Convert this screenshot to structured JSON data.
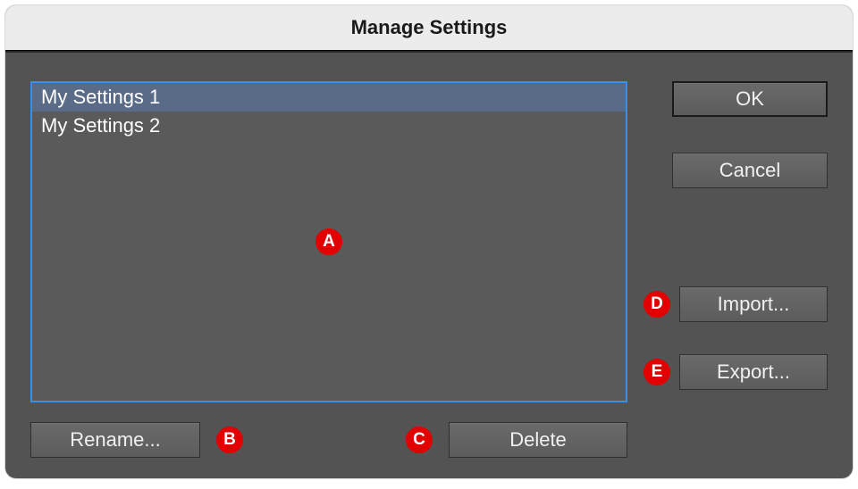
{
  "title": "Manage Settings",
  "list": {
    "items": [
      "My Settings 1",
      "My Settings 2"
    ],
    "selected_index": 0
  },
  "buttons": {
    "ok": "OK",
    "cancel": "Cancel",
    "import": "Import...",
    "export": "Export...",
    "rename": "Rename...",
    "delete": "Delete"
  },
  "badges": {
    "a": "A",
    "b": "B",
    "c": "C",
    "d": "D",
    "e": "E"
  }
}
